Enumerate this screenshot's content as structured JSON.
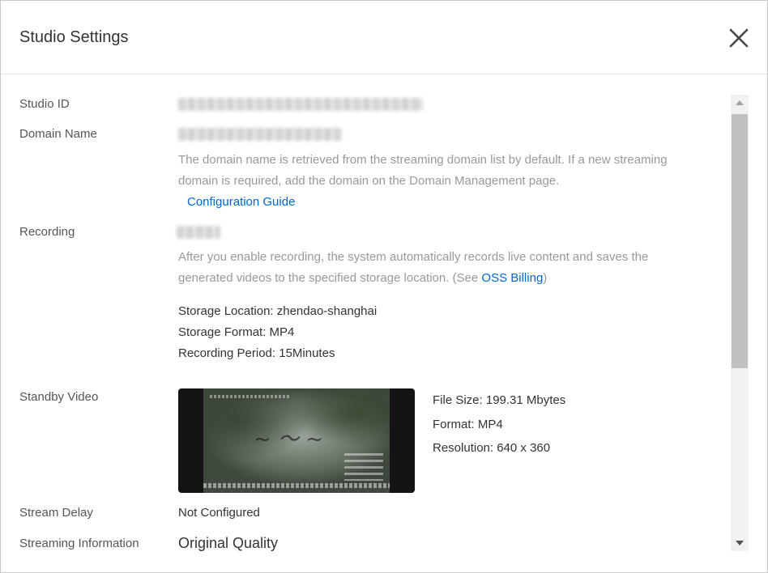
{
  "dialog": {
    "title": "Studio Settings",
    "close_icon": "close-icon"
  },
  "fields": {
    "studio_id": {
      "label": "Studio ID"
    },
    "domain_name": {
      "label": "Domain Name",
      "description": "The domain name is retrieved from the streaming domain list by default. If a new streaming domain is required, add the domain on the Domain Management page.",
      "link": "Configuration Guide"
    },
    "recording": {
      "label": "Recording",
      "description_prefix": "After you enable recording, the system automatically records live content and saves the generated videos to the specified storage location. (See ",
      "description_link": "OSS Billing",
      "description_suffix": ")",
      "storage_location": "Storage Location: zhendao-shanghai",
      "storage_format": "Storage Format: MP4",
      "recording_period": "Recording Period: 15Minutes"
    },
    "standby_video": {
      "label": "Standby Video",
      "file_size": "File Size: 199.31 Mbytes",
      "format": "Format: MP4",
      "resolution": "Resolution: 640 x 360"
    },
    "stream_delay": {
      "label": "Stream Delay",
      "value": "Not Configured"
    },
    "streaming_information": {
      "label": "Streaming Information",
      "value": "Original Quality"
    }
  },
  "colors": {
    "link": "#0066cc",
    "muted_text": "#999999",
    "label_text": "#555555"
  }
}
